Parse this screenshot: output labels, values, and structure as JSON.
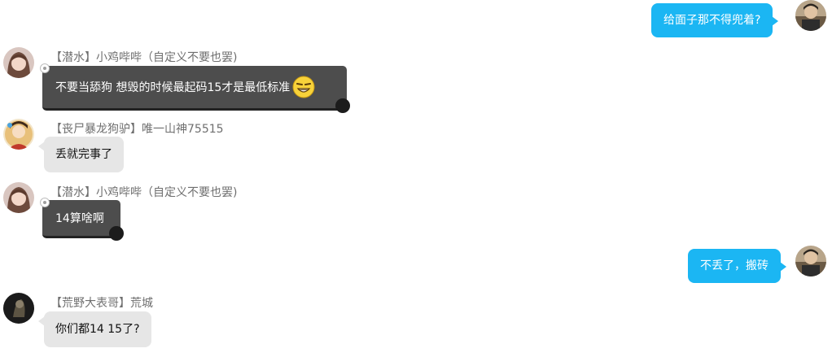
{
  "messages": [
    {
      "side": "right",
      "text": "给面子那不得兜着?",
      "avatar": "user-avatar"
    },
    {
      "side": "left",
      "sender": "【潜水】小鸡哔哔（自定义不要也罢)",
      "text": "不要当舔狗 想毁的时候最起码15才是最低标准",
      "emoji": "grin-emoji-icon",
      "bubble_style": "dark"
    },
    {
      "side": "left",
      "sender": "【丧尸暴龙狗驴】唯一山神75515",
      "text": "丢就完事了",
      "bubble_style": "gray"
    },
    {
      "side": "left",
      "sender": "【潜水】小鸡哔哔（自定义不要也罢)",
      "text": "14算啥啊",
      "bubble_style": "dark"
    },
    {
      "side": "right",
      "text": "不丢了，搬砖",
      "avatar": "user-avatar"
    },
    {
      "side": "left",
      "sender": "【荒野大表哥】荒城",
      "text": "你们都14 15了?",
      "bubble_style": "gray"
    }
  ],
  "colors": {
    "my_bubble": "#1bb6f3",
    "gray_bubble": "#e6e6e6",
    "dark_bubble": "#4d4d4d",
    "sender_text": "#6f6f6f"
  }
}
